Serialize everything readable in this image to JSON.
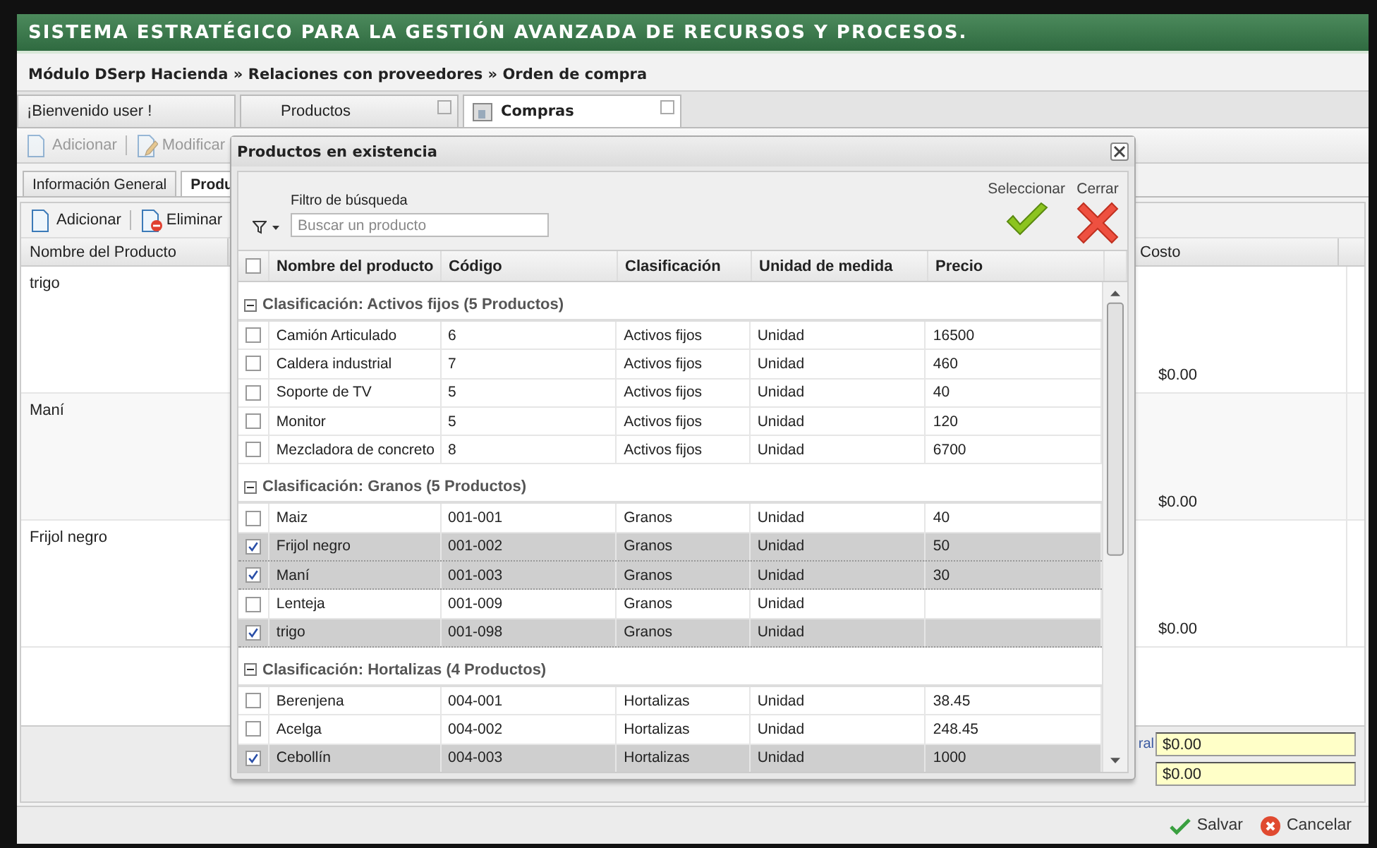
{
  "app_title": "SISTEMA ESTRATÉGICO PARA LA GESTIÓN AVANZADA DE RECURSOS Y PROCESOS.",
  "breadcrumb": "Módulo DSerp Hacienda » Relaciones con proveedores » Orden de compra",
  "tabs": [
    {
      "label": "¡Bienvenido user !",
      "selected": false,
      "closable": false
    },
    {
      "label": "Productos",
      "selected": false,
      "closable": true
    },
    {
      "label": "Compras",
      "selected": true,
      "closable": true
    }
  ],
  "toolbar": [
    {
      "label": "Adicionar",
      "kind": "add",
      "disabled": true
    },
    {
      "label": "Modificar",
      "kind": "edit",
      "disabled": true
    }
  ],
  "subtabs": [
    {
      "label": "Información General",
      "selected": false
    },
    {
      "label": "Produ",
      "selected": true
    }
  ],
  "grid_toolbar": [
    {
      "label": "Adicionar",
      "kind": "add",
      "disabled": false
    },
    {
      "label": "Eliminar",
      "kind": "delete",
      "disabled": false
    }
  ],
  "grid": {
    "columns": [
      "Nombre del Producto",
      "Costo"
    ],
    "rows": [
      {
        "name": "trigo",
        "cost": "$0.00"
      },
      {
        "name": "Maní",
        "cost": "$0.00"
      },
      {
        "name": "Frijol negro",
        "cost": "$0.00"
      }
    ]
  },
  "totals": [
    {
      "label": "ral",
      "value": "$0.00"
    },
    {
      "value": "$0.00"
    }
  ],
  "actions": [
    {
      "label": "Salvar",
      "kind": "save"
    },
    {
      "label": "Cancelar",
      "kind": "cancel"
    }
  ],
  "dialog": {
    "title": "Productos en existencia",
    "filter_label": "Filtro de búsqueda",
    "search": {
      "placeholder": "Buscar un producto"
    },
    "buttons": [
      {
        "label": "Seleccionar",
        "kind": "select"
      },
      {
        "label": "Cerrar",
        "kind": "close"
      }
    ],
    "header_checked": false,
    "columns": [
      "Nombre del producto",
      "Código",
      "Clasificación",
      "Unidad de medida",
      "Precio"
    ],
    "groups": [
      {
        "label": "Clasificación: Activos fijos (5 Productos)",
        "expanded": true,
        "rows": [
          {
            "name": "Camión Articulado",
            "code": "6",
            "class": "Activos fijos",
            "unit": "Unidad",
            "price": "16500",
            "checked": false
          },
          {
            "name": "Caldera industrial",
            "code": "7",
            "class": "Activos fijos",
            "unit": "Unidad",
            "price": "460",
            "checked": false
          },
          {
            "name": "Soporte de TV",
            "code": "5",
            "class": "Activos fijos",
            "unit": "Unidad",
            "price": "40",
            "checked": false
          },
          {
            "name": "Monitor",
            "code": "5",
            "class": "Activos fijos",
            "unit": "Unidad",
            "price": "120",
            "checked": false
          },
          {
            "name": "Mezcladora de concreto",
            "code": "8",
            "class": "Activos fijos",
            "unit": "Unidad",
            "price": "6700",
            "checked": false
          }
        ]
      },
      {
        "label": "Clasificación: Granos (5 Productos)",
        "expanded": true,
        "rows": [
          {
            "name": "Maiz",
            "code": "001-001",
            "class": "Granos",
            "unit": "Unidad",
            "price": "40",
            "checked": false
          },
          {
            "name": "Frijol negro",
            "code": "001-002",
            "class": "Granos",
            "unit": "Unidad",
            "price": "50",
            "checked": true
          },
          {
            "name": "Maní",
            "code": "001-003",
            "class": "Granos",
            "unit": "Unidad",
            "price": "30",
            "checked": true
          },
          {
            "name": "Lenteja",
            "code": "001-009",
            "class": "Granos",
            "unit": "Unidad",
            "checked": false
          },
          {
            "name": "trigo",
            "code": "001-098",
            "class": "Granos",
            "unit": "Unidad",
            "checked": true
          }
        ]
      },
      {
        "label": "Clasificación: Hortalizas (4 Productos)",
        "expanded": true,
        "rows": [
          {
            "name": "Berenjena",
            "code": "004-001",
            "class": "Hortalizas",
            "unit": "Unidad",
            "price": "38.45",
            "checked": false
          },
          {
            "name": "Acelga",
            "code": "004-002",
            "class": "Hortalizas",
            "unit": "Unidad",
            "price": "248.45",
            "checked": false
          },
          {
            "name": "Cebollín",
            "code": "004-003",
            "class": "Hortalizas",
            "unit": "Unidad",
            "price": "1000",
            "checked": true
          }
        ]
      }
    ]
  }
}
